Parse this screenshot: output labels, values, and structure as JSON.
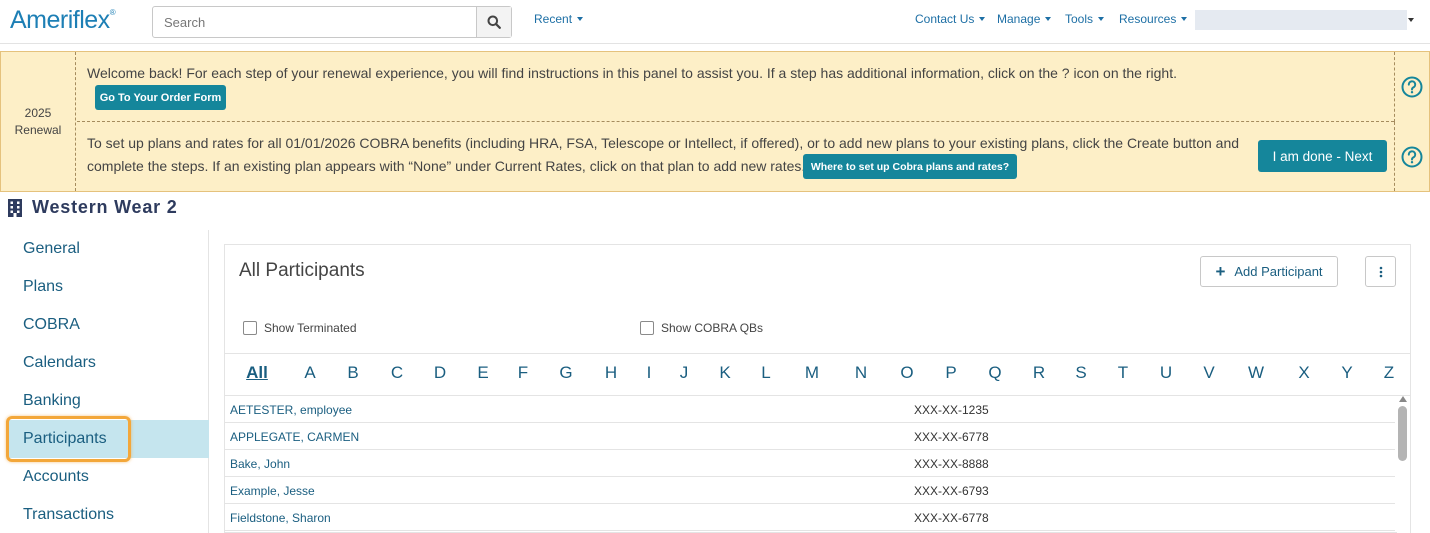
{
  "header": {
    "logo_text": "Ameriflex",
    "logo_mark": "®",
    "search_placeholder": "Search",
    "search_icon": "search-icon",
    "recent_label": "Recent",
    "contact_label": "Contact Us",
    "manage_label": "Manage",
    "tools_label": "Tools",
    "resources_label": "Resources"
  },
  "banner": {
    "year": "2025",
    "label": "Renewal",
    "welcome_text": "Welcome back! For each step of your renewal experience, you will find instructions in this panel to assist you. If a step has additional information, click on the ? icon on the right.",
    "order_button": "Go To Your Order Form",
    "cobra_text_line1": "To set up plans and rates for all 01/01/2026 COBRA benefits (including HRA, FSA, Telescope or Intellect, if offered), or to add new plans to your existing plans, click the Create button and",
    "cobra_text_line2": "complete the steps. If an existing plan appears with “None” under Current Rates, click on that plan to add new rates.",
    "cobra_button": "Where to set up Cobra plans and rates?",
    "next_button": "I am done - Next",
    "help_icon": "question-circle-icon"
  },
  "company": {
    "icon": "building-icon",
    "name": "Western Wear 2"
  },
  "sidebar": {
    "items": [
      {
        "label": "General"
      },
      {
        "label": "Plans"
      },
      {
        "label": "COBRA"
      },
      {
        "label": "Calendars"
      },
      {
        "label": "Banking"
      },
      {
        "label": "Participants",
        "active": true
      },
      {
        "label": "Accounts"
      },
      {
        "label": "Transactions"
      }
    ]
  },
  "main": {
    "title": "All Participants",
    "add_button": "Add Participant",
    "show_terminated": "Show Terminated",
    "show_cobra_qbs": "Show COBRA QBs",
    "letters": [
      "All",
      "A",
      "B",
      "C",
      "D",
      "E",
      "F",
      "G",
      "H",
      "I",
      "J",
      "K",
      "L",
      "M",
      "N",
      "O",
      "P",
      "Q",
      "R",
      "S",
      "T",
      "U",
      "V",
      "W",
      "X",
      "Y",
      "Z"
    ],
    "participants": [
      {
        "name": "AETESTER, employee",
        "ssn": "XXX-XX-1235"
      },
      {
        "name": "APPLEGATE, CARMEN",
        "ssn": "XXX-XX-6778"
      },
      {
        "name": "Bake, John",
        "ssn": "XXX-XX-8888"
      },
      {
        "name": "Example, Jesse",
        "ssn": "XXX-XX-6793"
      },
      {
        "name": "Fieldstone, Sharon",
        "ssn": "XXX-XX-6778"
      }
    ]
  },
  "colors": {
    "brand": "#1d7fb5",
    "teal_button": "#15869b",
    "banner_bg": "#fdefc7",
    "active_nav": "#c5e5ee",
    "highlight": "#f3a73a"
  }
}
